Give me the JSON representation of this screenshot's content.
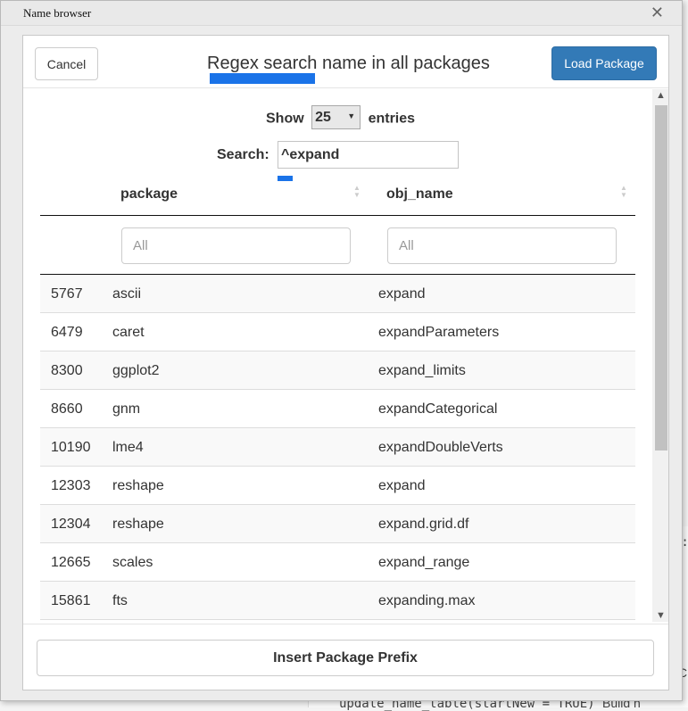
{
  "window": {
    "title": "Name browser"
  },
  "background": {
    "code_line": "update_name_table(startNew = TRUE)",
    "code_tail": "Build n"
  },
  "dialog": {
    "cancel_label": "Cancel",
    "title": "Regex search name in all packages",
    "load_label": "Load Package"
  },
  "table_controls": {
    "show_label": "Show",
    "page_length": "25",
    "entries_label": "entries",
    "search_label": "Search:",
    "search_value": "^expand"
  },
  "table": {
    "columns": [
      "package",
      "obj_name"
    ],
    "filter_placeholder": "All",
    "rows": [
      {
        "id": "5767",
        "package": "ascii",
        "obj_name": "expand"
      },
      {
        "id": "6479",
        "package": "caret",
        "obj_name": "expandParameters"
      },
      {
        "id": "8300",
        "package": "ggplot2",
        "obj_name": "expand_limits"
      },
      {
        "id": "8660",
        "package": "gnm",
        "obj_name": "expandCategorical"
      },
      {
        "id": "10190",
        "package": "lme4",
        "obj_name": "expandDoubleVerts"
      },
      {
        "id": "12303",
        "package": "reshape",
        "obj_name": "expand"
      },
      {
        "id": "12304",
        "package": "reshape",
        "obj_name": "expand.grid.df"
      },
      {
        "id": "12665",
        "package": "scales",
        "obj_name": "expand_range"
      },
      {
        "id": "15861",
        "package": "fts",
        "obj_name": "expanding.max"
      }
    ]
  },
  "footer": {
    "insert_label": "Insert Package Prefix"
  },
  "colors": {
    "primary": "#337ab7",
    "highlight": "#1a73e8"
  }
}
